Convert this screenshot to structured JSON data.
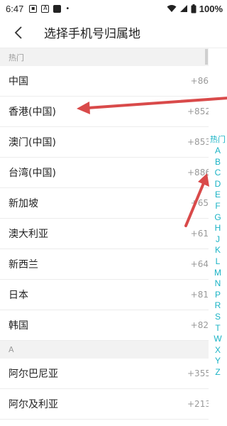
{
  "status_bar": {
    "time": "6:47",
    "left_icons": [
      "image-icon",
      "font-a-icon",
      "stop-square-icon",
      "dot-icon"
    ],
    "battery_text": "100%"
  },
  "header": {
    "title": "选择手机号归属地"
  },
  "sections": [
    {
      "title": "热门",
      "rows": [
        {
          "name": "中国",
          "code": "+86"
        },
        {
          "name": "香港(中国)",
          "code": "+852"
        },
        {
          "name": "澳门(中国)",
          "code": "+853"
        },
        {
          "name": "台湾(中国)",
          "code": "+886"
        },
        {
          "name": "新加坡",
          "code": "+65"
        },
        {
          "name": "澳大利亚",
          "code": "+61"
        },
        {
          "name": "新西兰",
          "code": "+64"
        },
        {
          "name": "日本",
          "code": "+81"
        },
        {
          "name": "韩国",
          "code": "+82"
        }
      ]
    },
    {
      "title": "A",
      "rows": [
        {
          "name": "阿尔巴尼亚",
          "code": "+355"
        },
        {
          "name": "阿尔及利亚",
          "code": "+213"
        }
      ]
    }
  ],
  "index_bar": [
    "热门",
    "A",
    "B",
    "C",
    "D",
    "E",
    "F",
    "G",
    "H",
    "J",
    "K",
    "L",
    "M",
    "N",
    "P",
    "R",
    "S",
    "T",
    "W",
    "X",
    "Y",
    "Z"
  ],
  "colors": {
    "accent": "#1ab3c5",
    "annotation_arrow": "#d94a4a",
    "section_bg": "#f2f2f2"
  }
}
